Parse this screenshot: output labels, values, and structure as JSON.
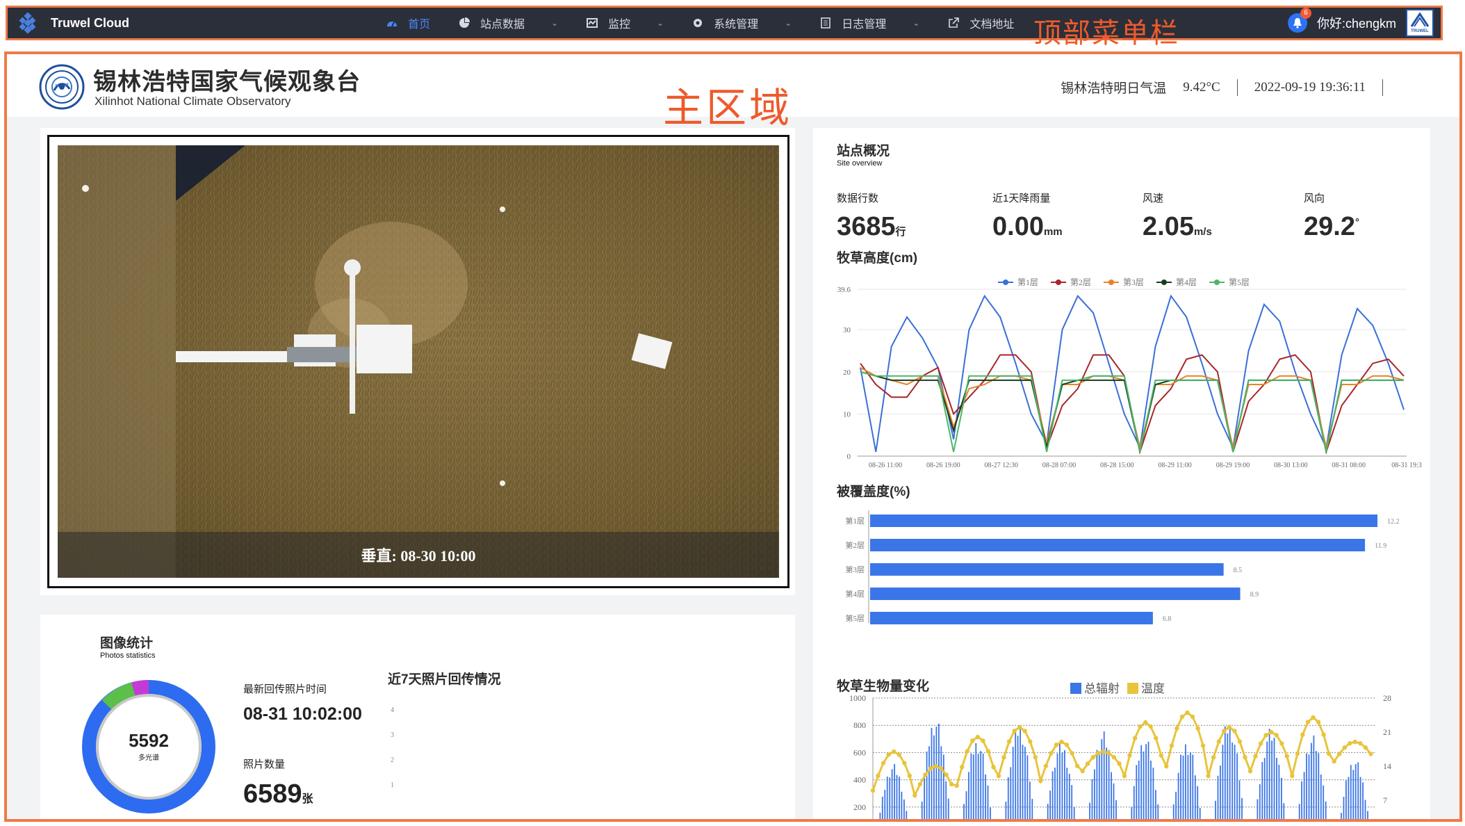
{
  "nav": {
    "brand": "Truwel Cloud",
    "items": [
      {
        "label": "首页",
        "icon": "dashboard-icon",
        "active": true,
        "dropdown": false
      },
      {
        "label": "站点数据",
        "icon": "pie-chart-icon",
        "active": false,
        "dropdown": true
      },
      {
        "label": "监控",
        "icon": "monitor-icon",
        "active": false,
        "dropdown": true
      },
      {
        "label": "系统管理",
        "icon": "gear-icon",
        "active": false,
        "dropdown": true
      },
      {
        "label": "日志管理",
        "icon": "log-icon",
        "active": false,
        "dropdown": true
      },
      {
        "label": "文档地址",
        "icon": "external-link-icon",
        "active": false,
        "dropdown": false
      }
    ],
    "annotation": "顶部菜单栏",
    "badge": "6",
    "greeting": "你好:chengkm",
    "user_logo_text": "TRUWEL"
  },
  "header": {
    "title_cn": "锡林浩特国家气候观象台",
    "title_en": "Xilinhot National Climate Observatory",
    "annotation": "主区域",
    "temp_label": "锡林浩特明日气温",
    "temp_value": "9.42°C",
    "datetime": "2022-09-19 19:36:11"
  },
  "photo": {
    "caption": "垂直: 08-30 10:00"
  },
  "stats": {
    "title": "图像统计",
    "subtitle": "Photos statistics",
    "donut_value": "5592",
    "donut_label": "多光谱",
    "latest_label": "最新回传照片时间",
    "latest_value": "08-31 10:02:00",
    "count_label": "照片数量",
    "count_value": "6589",
    "count_unit": "张",
    "week_title": "近7天照片回传情况",
    "week_ticks": [
      "4",
      "3",
      "2",
      "1"
    ]
  },
  "overview": {
    "title": "站点概况",
    "subtitle": "Site overview",
    "metrics": [
      {
        "label": "数据行数",
        "value": "3685",
        "unit": "行"
      },
      {
        "label": "近1天降雨量",
        "value": "0.00",
        "unit": "mm"
      },
      {
        "label": "风速",
        "value": "2.05",
        "unit": "m/s"
      },
      {
        "label": "风向",
        "value": "29.2",
        "unit": "°"
      }
    ]
  },
  "chart_data": [
    {
      "type": "line",
      "title": "牧草高度(cm)",
      "x": [
        "08-26 11:00",
        "08-26 19:00",
        "08-27 12:30",
        "08-28 07:00",
        "08-28 15:00",
        "08-29 11:00",
        "08-29 19:00",
        "08-30 13:00",
        "08-31 08:00",
        "08-31 19:3"
      ],
      "ylim": [
        0,
        39.6
      ],
      "yticks": [
        "0",
        "10",
        "20",
        "30",
        "39.6"
      ],
      "legend": "top",
      "series": [
        {
          "name": "第1层",
          "color": "#3a6fd8",
          "values": [
            21,
            1,
            26,
            33,
            28,
            21,
            4,
            30,
            38,
            33,
            22,
            10,
            3,
            30,
            38,
            34,
            22,
            10,
            2,
            26,
            38,
            33,
            22,
            10,
            2,
            25,
            36,
            32,
            20,
            10,
            2,
            24,
            35,
            31,
            22,
            11
          ]
        },
        {
          "name": "第2层",
          "color": "#a8262a",
          "values": [
            22,
            17,
            14,
            14,
            19,
            21,
            10,
            14,
            18,
            24,
            24,
            20,
            2,
            12,
            16,
            24,
            24,
            19,
            1,
            12,
            16,
            23,
            24,
            20,
            1,
            13,
            17,
            23,
            24,
            20,
            1,
            12,
            17,
            22,
            23,
            19
          ]
        },
        {
          "name": "第3层",
          "color": "#e8832a",
          "values": [
            21,
            19,
            18,
            17,
            19,
            19,
            7,
            16,
            17,
            19,
            19,
            18,
            3,
            17,
            17,
            19,
            19,
            18,
            2,
            17,
            17,
            19,
            19,
            18,
            2,
            17,
            17,
            19,
            19,
            18,
            2,
            17,
            17,
            19,
            19,
            18
          ]
        },
        {
          "name": "第4层",
          "color": "#173d21",
          "values": [
            20,
            19,
            18,
            18,
            18,
            18,
            6,
            18,
            18,
            18,
            18,
            18,
            2,
            17,
            18,
            18,
            18,
            18,
            1,
            17,
            18,
            18,
            18,
            18,
            1,
            18,
            18,
            18,
            18,
            18,
            1,
            18,
            18,
            18,
            18,
            18
          ]
        },
        {
          "name": "第5层",
          "color": "#4ab769",
          "values": [
            20,
            19,
            19,
            19,
            19,
            19,
            1,
            19,
            19,
            19,
            19,
            19,
            1,
            18,
            18,
            19,
            19,
            19,
            1,
            18,
            18,
            18,
            18,
            18,
            1,
            18,
            18,
            18,
            18,
            18,
            1,
            18,
            18,
            18,
            18,
            18
          ]
        }
      ]
    },
    {
      "type": "bar",
      "title": "被覆盖度(%)",
      "orientation": "horizontal",
      "categories": [
        "第1层",
        "第2层",
        "第3层",
        "第4层",
        "第5层"
      ],
      "values": [
        12.2,
        11.9,
        8.5,
        8.9,
        6.8
      ],
      "value_labels": [
        "12.2",
        "11.9",
        "8.5",
        "8.9",
        "6.8"
      ],
      "xlim": [
        0,
        12.5
      ],
      "color": "#3b76e8"
    },
    {
      "type": "bar",
      "title": "牧草生物量变化",
      "legend": "top",
      "left_axis": [
        "1000",
        "800",
        "600",
        "400",
        "200"
      ],
      "right_axis": [
        "28",
        "21",
        "14",
        "7"
      ],
      "ylim_left": [
        0,
        1000
      ],
      "ylim_right": [
        0,
        28
      ],
      "series": [
        {
          "name": "总辐射",
          "color": "#3b76e8",
          "kind": "bar",
          "daily_peak": [
            520,
            860,
            700,
            820,
            680,
            760,
            720,
            690,
            840,
            780,
            730,
            560
          ]
        },
        {
          "name": "温度",
          "color": "#e8c43b",
          "kind": "line",
          "daily_range": [
            [
              17,
              9
            ],
            [
              14,
              8
            ],
            [
              20,
              10
            ],
            [
              22,
              12
            ],
            [
              19,
              11
            ],
            [
              17,
              13
            ],
            [
              23,
              12
            ],
            [
              25,
              14
            ],
            [
              22,
              12
            ],
            [
              21,
              13
            ],
            [
              24,
              12
            ],
            [
              19,
              15
            ]
          ]
        }
      ]
    }
  ],
  "colors": {
    "nav_bg": "#2b2f3a",
    "annotation": "#ee5a2b",
    "accent": "#3b76e8"
  }
}
